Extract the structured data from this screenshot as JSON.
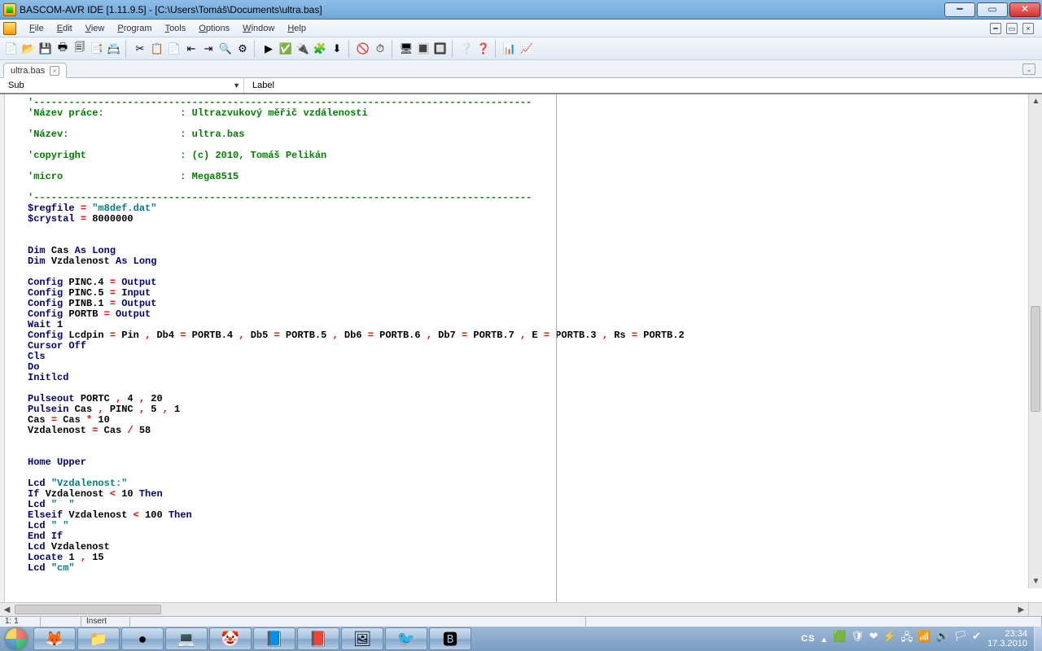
{
  "titlebar": {
    "text": "BASCOM-AVR IDE [1.11.9.5] - [C:\\Users\\Tomáš\\Documents\\ultra.bas]"
  },
  "menus": [
    "File",
    "Edit",
    "View",
    "Program",
    "Tools",
    "Options",
    "Window",
    "Help"
  ],
  "menus_accel_index": [
    0,
    0,
    0,
    0,
    0,
    0,
    0,
    0
  ],
  "tab": {
    "name": "ultra.bas"
  },
  "subbar": {
    "left_label": "Sub",
    "right_label": "Label"
  },
  "statusbar": {
    "pos": "1: 1",
    "mode": "Insert"
  },
  "taskbar": {
    "lang": "CS",
    "time": "23:34",
    "date": "17.3.2010"
  },
  "code_lines": [
    {
      "cls": "c-green",
      "txt": "'-------------------------------------------------------------------------------------"
    },
    {
      "cls": "c-green",
      "txt": "'Název práce:             : Ultrazvukový měřič vzdálenosti"
    },
    {
      "cls": "c-green",
      "txt": ""
    },
    {
      "cls": "c-green",
      "txt": "'Název:                   : ultra.bas"
    },
    {
      "cls": "c-green",
      "txt": ""
    },
    {
      "cls": "c-green",
      "txt": "'copyright                : (c) 2010, Tomáš Pelikán"
    },
    {
      "cls": "c-green",
      "txt": ""
    },
    {
      "cls": "c-green",
      "txt": "'micro                    : Mega8515"
    },
    {
      "cls": "c-green",
      "txt": ""
    },
    {
      "cls": "c-green",
      "txt": "'-------------------------------------------------------------------------------------"
    },
    {
      "spans": [
        {
          "cls": "c-navy",
          "t": "$regfile "
        },
        {
          "cls": "c-red",
          "t": "="
        },
        {
          "cls": "",
          "t": " "
        },
        {
          "cls": "c-teal",
          "t": "\"m8def.dat\""
        }
      ]
    },
    {
      "spans": [
        {
          "cls": "c-navy",
          "t": "$crystal "
        },
        {
          "cls": "c-red",
          "t": "="
        },
        {
          "cls": "",
          "t": " 8000000"
        }
      ]
    },
    {
      "cls": "",
      "txt": ""
    },
    {
      "cls": "",
      "txt": ""
    },
    {
      "spans": [
        {
          "cls": "c-navy",
          "t": "Dim "
        },
        {
          "cls": "",
          "t": "Cas "
        },
        {
          "cls": "c-navy",
          "t": "As Long"
        }
      ]
    },
    {
      "spans": [
        {
          "cls": "c-navy",
          "t": "Dim "
        },
        {
          "cls": "",
          "t": "Vzdalenost "
        },
        {
          "cls": "c-navy",
          "t": "As Long"
        }
      ]
    },
    {
      "cls": "",
      "txt": ""
    },
    {
      "spans": [
        {
          "cls": "c-navy",
          "t": "Config "
        },
        {
          "cls": "",
          "t": "PINC.4 "
        },
        {
          "cls": "c-red",
          "t": "="
        },
        {
          "cls": "c-navy",
          "t": " Output"
        }
      ]
    },
    {
      "spans": [
        {
          "cls": "c-navy",
          "t": "Config "
        },
        {
          "cls": "",
          "t": "PINC.5 "
        },
        {
          "cls": "c-red",
          "t": "="
        },
        {
          "cls": "c-navy",
          "t": " Input"
        }
      ]
    },
    {
      "spans": [
        {
          "cls": "c-navy",
          "t": "Config "
        },
        {
          "cls": "",
          "t": "PINB.1 "
        },
        {
          "cls": "c-red",
          "t": "="
        },
        {
          "cls": "c-navy",
          "t": " Output"
        }
      ]
    },
    {
      "spans": [
        {
          "cls": "c-navy",
          "t": "Config "
        },
        {
          "cls": "",
          "t": "PORTB "
        },
        {
          "cls": "c-red",
          "t": "="
        },
        {
          "cls": "c-navy",
          "t": " Output"
        }
      ]
    },
    {
      "spans": [
        {
          "cls": "c-navy",
          "t": "Wait "
        },
        {
          "cls": "",
          "t": "1"
        }
      ]
    },
    {
      "spans": [
        {
          "cls": "c-navy",
          "t": "Config "
        },
        {
          "cls": "",
          "t": "Lcdpin "
        },
        {
          "cls": "c-red",
          "t": "="
        },
        {
          "cls": "",
          "t": " Pin "
        },
        {
          "cls": "c-red",
          "t": ","
        },
        {
          "cls": "",
          "t": " Db4 "
        },
        {
          "cls": "c-red",
          "t": "="
        },
        {
          "cls": "",
          "t": " PORTB.4 "
        },
        {
          "cls": "c-red",
          "t": ","
        },
        {
          "cls": "",
          "t": " Db5 "
        },
        {
          "cls": "c-red",
          "t": "="
        },
        {
          "cls": "",
          "t": " PORTB.5 "
        },
        {
          "cls": "c-red",
          "t": ","
        },
        {
          "cls": "",
          "t": " Db6 "
        },
        {
          "cls": "c-red",
          "t": "="
        },
        {
          "cls": "",
          "t": " PORTB.6 "
        },
        {
          "cls": "c-red",
          "t": ","
        },
        {
          "cls": "",
          "t": " Db7 "
        },
        {
          "cls": "c-red",
          "t": "="
        },
        {
          "cls": "",
          "t": " PORTB.7 "
        },
        {
          "cls": "c-red",
          "t": ","
        },
        {
          "cls": "",
          "t": " E "
        },
        {
          "cls": "c-red",
          "t": "="
        },
        {
          "cls": "",
          "t": " PORTB.3 "
        },
        {
          "cls": "c-red",
          "t": ","
        },
        {
          "cls": "",
          "t": " Rs "
        },
        {
          "cls": "c-red",
          "t": "="
        },
        {
          "cls": "",
          "t": " PORTB.2"
        }
      ]
    },
    {
      "spans": [
        {
          "cls": "c-navy",
          "t": "Cursor Off"
        }
      ]
    },
    {
      "spans": [
        {
          "cls": "c-navy",
          "t": "Cls"
        }
      ]
    },
    {
      "spans": [
        {
          "cls": "c-navy",
          "t": "Do"
        }
      ]
    },
    {
      "spans": [
        {
          "cls": "c-navy",
          "t": "Initlcd"
        }
      ]
    },
    {
      "cls": "",
      "txt": ""
    },
    {
      "spans": [
        {
          "cls": "c-navy",
          "t": "Pulseout "
        },
        {
          "cls": "",
          "t": "PORTC "
        },
        {
          "cls": "c-red",
          "t": ","
        },
        {
          "cls": "",
          "t": " 4 "
        },
        {
          "cls": "c-red",
          "t": ","
        },
        {
          "cls": "",
          "t": " 20"
        }
      ]
    },
    {
      "spans": [
        {
          "cls": "c-navy",
          "t": "Pulsein "
        },
        {
          "cls": "",
          "t": "Cas "
        },
        {
          "cls": "c-red",
          "t": ","
        },
        {
          "cls": "",
          "t": " PINC "
        },
        {
          "cls": "c-red",
          "t": ","
        },
        {
          "cls": "",
          "t": " 5 "
        },
        {
          "cls": "c-red",
          "t": ","
        },
        {
          "cls": "",
          "t": " 1"
        }
      ]
    },
    {
      "spans": [
        {
          "cls": "",
          "t": "Cas "
        },
        {
          "cls": "c-red",
          "t": "="
        },
        {
          "cls": "",
          "t": " Cas "
        },
        {
          "cls": "c-red",
          "t": "*"
        },
        {
          "cls": "",
          "t": " 10"
        }
      ]
    },
    {
      "spans": [
        {
          "cls": "",
          "t": "Vzdalenost "
        },
        {
          "cls": "c-red",
          "t": "="
        },
        {
          "cls": "",
          "t": " Cas "
        },
        {
          "cls": "c-red",
          "t": "/"
        },
        {
          "cls": "",
          "t": " 58"
        }
      ]
    },
    {
      "cls": "",
      "txt": ""
    },
    {
      "cls": "",
      "txt": ""
    },
    {
      "spans": [
        {
          "cls": "c-navy",
          "t": "Home Upper"
        }
      ]
    },
    {
      "cls": "",
      "txt": ""
    },
    {
      "spans": [
        {
          "cls": "c-navy",
          "t": "Lcd "
        },
        {
          "cls": "c-teal",
          "t": "\"Vzdalenost:\""
        }
      ]
    },
    {
      "spans": [
        {
          "cls": "c-navy",
          "t": "If "
        },
        {
          "cls": "",
          "t": "Vzdalenost "
        },
        {
          "cls": "c-red",
          "t": "<"
        },
        {
          "cls": "",
          "t": " 10 "
        },
        {
          "cls": "c-navy",
          "t": "Then"
        }
      ]
    },
    {
      "spans": [
        {
          "cls": "c-navy",
          "t": "Lcd "
        },
        {
          "cls": "c-teal",
          "t": "\"  \""
        }
      ]
    },
    {
      "spans": [
        {
          "cls": "c-navy",
          "t": "Elseif "
        },
        {
          "cls": "",
          "t": "Vzdalenost "
        },
        {
          "cls": "c-red",
          "t": "<"
        },
        {
          "cls": "",
          "t": " 100 "
        },
        {
          "cls": "c-navy",
          "t": "Then"
        }
      ]
    },
    {
      "spans": [
        {
          "cls": "c-navy",
          "t": "Lcd "
        },
        {
          "cls": "c-teal",
          "t": "\" \""
        }
      ]
    },
    {
      "spans": [
        {
          "cls": "c-navy",
          "t": "End If"
        }
      ]
    },
    {
      "spans": [
        {
          "cls": "c-navy",
          "t": "Lcd "
        },
        {
          "cls": "",
          "t": "Vzdalenost"
        }
      ]
    },
    {
      "spans": [
        {
          "cls": "c-navy",
          "t": "Locate "
        },
        {
          "cls": "",
          "t": "1 "
        },
        {
          "cls": "c-red",
          "t": ","
        },
        {
          "cls": "",
          "t": " 15"
        }
      ]
    },
    {
      "spans": [
        {
          "cls": "c-navy",
          "t": "Lcd "
        },
        {
          "cls": "c-teal",
          "t": "\"cm\""
        }
      ]
    }
  ],
  "toolbar_icons": [
    "📄",
    "📂",
    "💾",
    "🖶",
    "🗐",
    "📑",
    "📇",
    "|",
    "✂",
    "📋",
    "📄",
    "⇤",
    "⇥",
    "🔍",
    "⚙",
    "|",
    "▶",
    "✅",
    "🔌",
    "🧩",
    "⬇",
    "|",
    "🚫",
    "⏱",
    "|",
    "🖥",
    "🔳",
    "🔲",
    "|",
    "❔",
    "❓",
    "|",
    "📊",
    "📈"
  ],
  "task_icons": [
    "🦊",
    "📁",
    "●",
    "💻",
    "🤡",
    "📘",
    "📕",
    "🖼",
    "🐦",
    "🅱"
  ]
}
